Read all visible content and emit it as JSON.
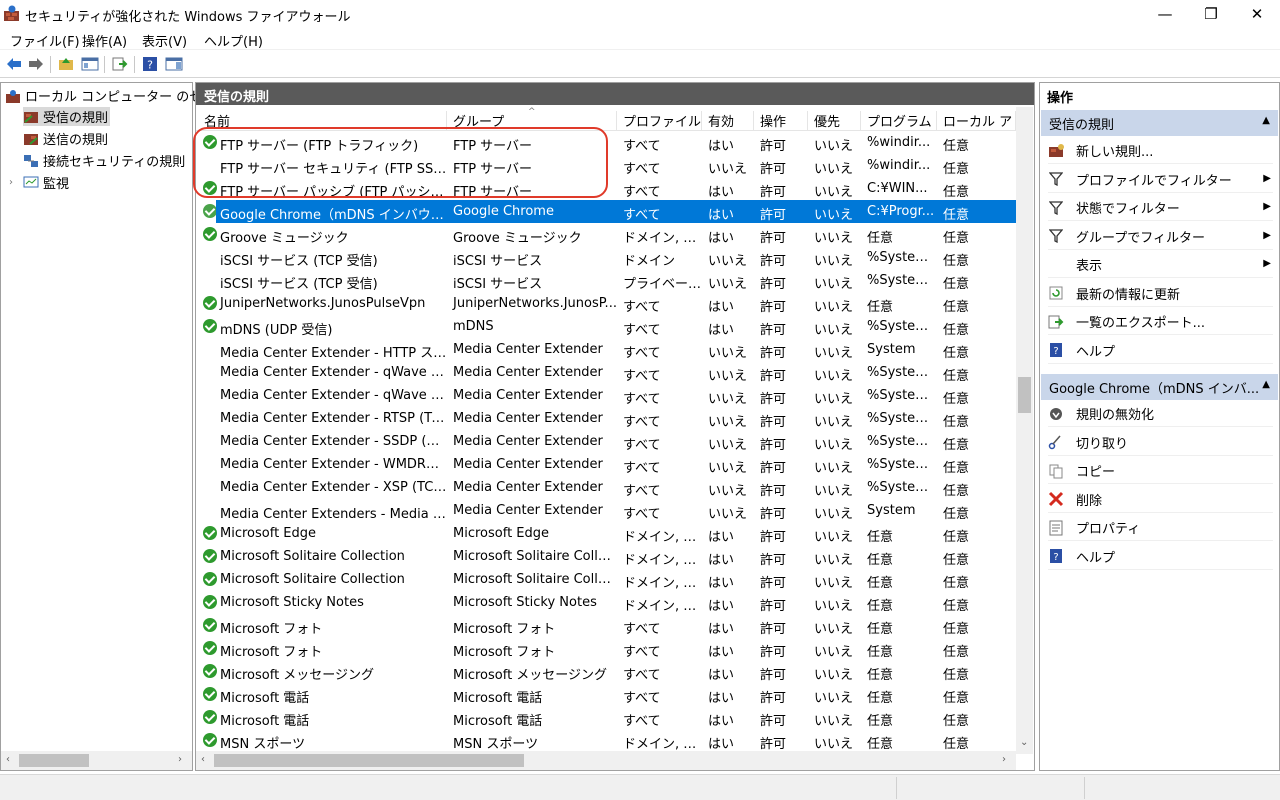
{
  "window": {
    "title": "セキュリティが強化された Windows ファイアウォール",
    "minimize": "—",
    "restore": "❐",
    "close": "✕"
  },
  "menu": [
    "ファイル(F)",
    "操作(A)",
    "表示(V)",
    "ヘルプ(H)"
  ],
  "tree": {
    "root": "ローカル コンピューター のセキュリ",
    "items": [
      "受信の規則",
      "送信の規則",
      "接続セキュリティの規則",
      "監視"
    ]
  },
  "center": {
    "header": "受信の規則",
    "columns": [
      "名前",
      "グループ",
      "プロファイル",
      "有効",
      "操作",
      "優先",
      "プログラム",
      "ローカル アドレ"
    ],
    "rows": [
      {
        "enabled": true,
        "name": "FTP サーバー (FTP トラフィック)",
        "group": "FTP サーバー",
        "profile": "すべて",
        "on": "はい",
        "action": "許可",
        "override": "いいえ",
        "program": "%windir...",
        "local": "任意"
      },
      {
        "enabled": false,
        "name": "FTP サーバー セキュリティ (FTP SSL トラ...",
        "group": "FTP サーバー",
        "profile": "すべて",
        "on": "いいえ",
        "action": "許可",
        "override": "いいえ",
        "program": "%windir...",
        "local": "任意"
      },
      {
        "enabled": true,
        "name": "FTP サーバー パッシブ (FTP パッシブ トラ...",
        "group": "FTP サーバー",
        "profile": "すべて",
        "on": "はい",
        "action": "許可",
        "override": "いいえ",
        "program": "C:¥WIN...",
        "local": "任意"
      },
      {
        "enabled": true,
        "selected": true,
        "name": "Google Chrome（mDNS インバウンド...",
        "group": "Google Chrome",
        "profile": "すべて",
        "on": "はい",
        "action": "許可",
        "override": "いいえ",
        "program": "C:¥Progr...",
        "local": "任意"
      },
      {
        "enabled": true,
        "name": "Groove ミュージック",
        "group": "Groove ミュージック",
        "profile": "ドメイン, プ...",
        "on": "はい",
        "action": "許可",
        "override": "いいえ",
        "program": "任意",
        "local": "任意"
      },
      {
        "enabled": false,
        "name": "iSCSI サービス (TCP 受信)",
        "group": "iSCSI サービス",
        "profile": "ドメイン",
        "on": "いいえ",
        "action": "許可",
        "override": "いいえ",
        "program": "%System...",
        "local": "任意"
      },
      {
        "enabled": false,
        "name": "iSCSI サービス (TCP 受信)",
        "group": "iSCSI サービス",
        "profile": "プライベート...",
        "on": "いいえ",
        "action": "許可",
        "override": "いいえ",
        "program": "%System...",
        "local": "任意"
      },
      {
        "enabled": true,
        "name": "JuniperNetworks.JunosPulseVpn",
        "group": "JuniperNetworks.JunosP...",
        "profile": "すべて",
        "on": "はい",
        "action": "許可",
        "override": "いいえ",
        "program": "任意",
        "local": "任意"
      },
      {
        "enabled": true,
        "name": "mDNS (UDP 受信)",
        "group": "mDNS",
        "profile": "すべて",
        "on": "はい",
        "action": "許可",
        "override": "いいえ",
        "program": "%System...",
        "local": "任意"
      },
      {
        "enabled": false,
        "name": "Media Center Extender - HTTP スト...",
        "group": "Media Center Extender",
        "profile": "すべて",
        "on": "いいえ",
        "action": "許可",
        "override": "いいえ",
        "program": "System",
        "local": "任意"
      },
      {
        "enabled": false,
        "name": "Media Center Extender - qWave (T...",
        "group": "Media Center Extender",
        "profile": "すべて",
        "on": "いいえ",
        "action": "許可",
        "override": "いいえ",
        "program": "%System...",
        "local": "任意"
      },
      {
        "enabled": false,
        "name": "Media Center Extender - qWave (U...",
        "group": "Media Center Extender",
        "profile": "すべて",
        "on": "いいえ",
        "action": "許可",
        "override": "いいえ",
        "program": "%System...",
        "local": "任意"
      },
      {
        "enabled": false,
        "name": "Media Center Extender - RTSP (TCP...",
        "group": "Media Center Extender",
        "profile": "すべて",
        "on": "いいえ",
        "action": "許可",
        "override": "いいえ",
        "program": "%System...",
        "local": "任意"
      },
      {
        "enabled": false,
        "name": "Media Center Extender - SSDP (UD...",
        "group": "Media Center Extender",
        "profile": "すべて",
        "on": "いいえ",
        "action": "許可",
        "override": "いいえ",
        "program": "%System...",
        "local": "任意"
      },
      {
        "enabled": false,
        "name": "Media Center Extender - WMDRM-...",
        "group": "Media Center Extender",
        "profile": "すべて",
        "on": "いいえ",
        "action": "許可",
        "override": "いいえ",
        "program": "%System...",
        "local": "任意"
      },
      {
        "enabled": false,
        "name": "Media Center Extender - XSP (TCP ...",
        "group": "Media Center Extender",
        "profile": "すべて",
        "on": "いいえ",
        "action": "許可",
        "override": "いいえ",
        "program": "%System...",
        "local": "任意"
      },
      {
        "enabled": false,
        "name": "Media Center Extenders - Media ス...",
        "group": "Media Center Extender",
        "profile": "すべて",
        "on": "いいえ",
        "action": "許可",
        "override": "いいえ",
        "program": "System",
        "local": "任意"
      },
      {
        "enabled": true,
        "name": "Microsoft Edge",
        "group": "Microsoft Edge",
        "profile": "ドメイン, プ...",
        "on": "はい",
        "action": "許可",
        "override": "いいえ",
        "program": "任意",
        "local": "任意"
      },
      {
        "enabled": true,
        "name": "Microsoft Solitaire Collection",
        "group": "Microsoft Solitaire Colle...",
        "profile": "ドメイン, プ...",
        "on": "はい",
        "action": "許可",
        "override": "いいえ",
        "program": "任意",
        "local": "任意"
      },
      {
        "enabled": true,
        "name": "Microsoft Solitaire Collection",
        "group": "Microsoft Solitaire Colle...",
        "profile": "ドメイン, プ...",
        "on": "はい",
        "action": "許可",
        "override": "いいえ",
        "program": "任意",
        "local": "任意"
      },
      {
        "enabled": true,
        "name": "Microsoft Sticky Notes",
        "group": "Microsoft Sticky Notes",
        "profile": "ドメイン, プ...",
        "on": "はい",
        "action": "許可",
        "override": "いいえ",
        "program": "任意",
        "local": "任意"
      },
      {
        "enabled": true,
        "name": "Microsoft フォト",
        "group": "Microsoft フォト",
        "profile": "すべて",
        "on": "はい",
        "action": "許可",
        "override": "いいえ",
        "program": "任意",
        "local": "任意"
      },
      {
        "enabled": true,
        "name": "Microsoft フォト",
        "group": "Microsoft フォト",
        "profile": "すべて",
        "on": "はい",
        "action": "許可",
        "override": "いいえ",
        "program": "任意",
        "local": "任意"
      },
      {
        "enabled": true,
        "name": "Microsoft メッセージング",
        "group": "Microsoft メッセージング",
        "profile": "すべて",
        "on": "はい",
        "action": "許可",
        "override": "いいえ",
        "program": "任意",
        "local": "任意"
      },
      {
        "enabled": true,
        "name": "Microsoft 電話",
        "group": "Microsoft 電話",
        "profile": "すべて",
        "on": "はい",
        "action": "許可",
        "override": "いいえ",
        "program": "任意",
        "local": "任意"
      },
      {
        "enabled": true,
        "name": "Microsoft 電話",
        "group": "Microsoft 電話",
        "profile": "すべて",
        "on": "はい",
        "action": "許可",
        "override": "いいえ",
        "program": "任意",
        "local": "任意"
      },
      {
        "enabled": true,
        "name": "MSN スポーツ",
        "group": "MSN スポーツ",
        "profile": "ドメイン, プ...",
        "on": "はい",
        "action": "許可",
        "override": "いいえ",
        "program": "任意",
        "local": "任意"
      }
    ]
  },
  "actions": {
    "header": "操作",
    "section1": "受信の規則",
    "section1_items": [
      {
        "label": "新しい規則...",
        "icon": "new-rule-icon",
        "submenu": false
      },
      {
        "label": "プロファイルでフィルター",
        "icon": "filter-icon",
        "submenu": true
      },
      {
        "label": "状態でフィルター",
        "icon": "filter-icon",
        "submenu": true
      },
      {
        "label": "グループでフィルター",
        "icon": "filter-icon",
        "submenu": true
      },
      {
        "label": "表示",
        "icon": "",
        "submenu": true
      },
      {
        "label": "最新の情報に更新",
        "icon": "refresh-icon",
        "submenu": false
      },
      {
        "label": "一覧のエクスポート...",
        "icon": "export-icon",
        "submenu": false
      },
      {
        "label": "ヘルプ",
        "icon": "help-icon",
        "submenu": false
      }
    ],
    "section2": "Google Chrome（mDNS インバ...",
    "section2_items": [
      {
        "label": "規則の無効化",
        "icon": "disable-rule-icon"
      },
      {
        "label": "切り取り",
        "icon": "cut-icon"
      },
      {
        "label": "コピー",
        "icon": "copy-icon"
      },
      {
        "label": "削除",
        "icon": "delete-icon"
      },
      {
        "label": "プロパティ",
        "icon": "properties-icon"
      },
      {
        "label": "ヘルプ",
        "icon": "help-icon"
      }
    ]
  },
  "colors": {
    "selection": "#0078d7",
    "section_bg": "#c9d6ea",
    "annotation": "#e03a2a",
    "enabled_check": "#2e9a2e"
  }
}
